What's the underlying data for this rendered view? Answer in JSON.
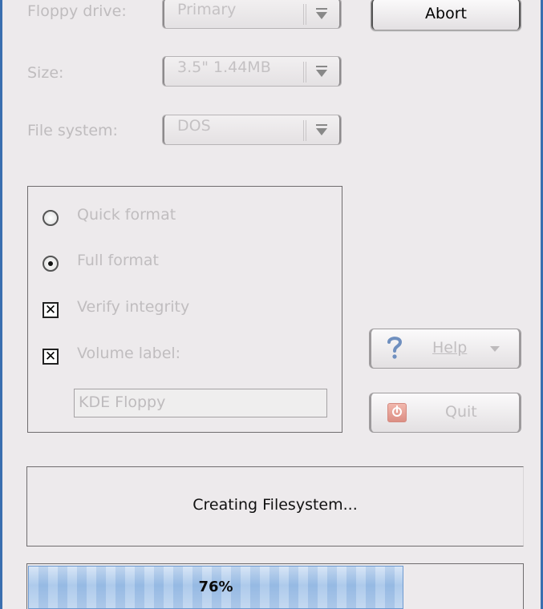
{
  "form": {
    "floppy_drive": {
      "label": "Floppy drive:",
      "value": "Primary"
    },
    "size": {
      "label": "Size:",
      "value": "3.5\" 1.44MB"
    },
    "file_system": {
      "label": "File system:",
      "value": "DOS"
    }
  },
  "buttons": {
    "abort": "Abort",
    "help": "Help",
    "quit": "Quit"
  },
  "options": {
    "quick_format": {
      "label": "Quick format",
      "selected": false
    },
    "full_format": {
      "label": "Full format",
      "selected": true
    },
    "verify_integrity": {
      "label": "Verify integrity",
      "checked": true
    },
    "volume_label": {
      "label": "Volume label:",
      "checked": true,
      "value": "KDE Floppy"
    }
  },
  "status": {
    "text": "Creating Filesystem..."
  },
  "progress": {
    "percent": 76,
    "label": "76%"
  },
  "colors": {
    "window_bg": "#edeaec",
    "progress_fill": "#9cbfe7",
    "frame": "#3a6fb0"
  },
  "icons": {
    "combo_arrow": "arrow-down-icon",
    "help": "question-mark-icon",
    "quit": "power-icon"
  }
}
